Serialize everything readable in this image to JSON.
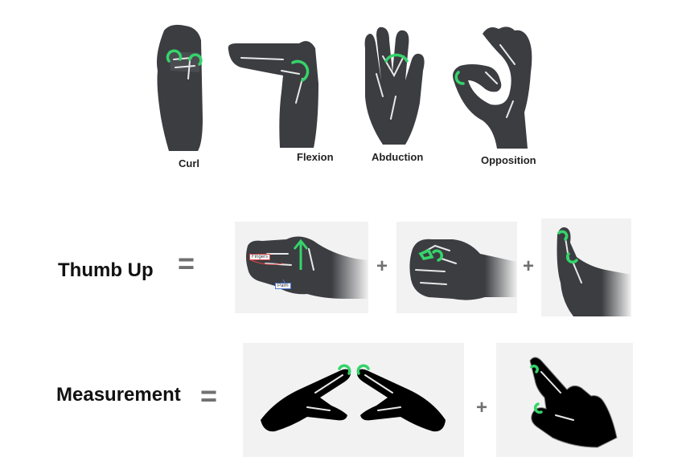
{
  "gestures": [
    {
      "label": "Curl"
    },
    {
      "label": "Flexion"
    },
    {
      "label": "Abduction"
    },
    {
      "label": "Opposition"
    }
  ],
  "thumb_up": {
    "label": "Thumb Up",
    "equals": "=",
    "plus": "+",
    "annotations": {
      "fingers": "Fingers",
      "palm": "Palm"
    }
  },
  "measurement": {
    "label": "Measurement",
    "equals": "=",
    "plus": "+"
  },
  "colors": {
    "hand": "#3b3d41",
    "highlight": "#35d46a",
    "panel": "#f2f2f2",
    "operator": "#707070"
  }
}
